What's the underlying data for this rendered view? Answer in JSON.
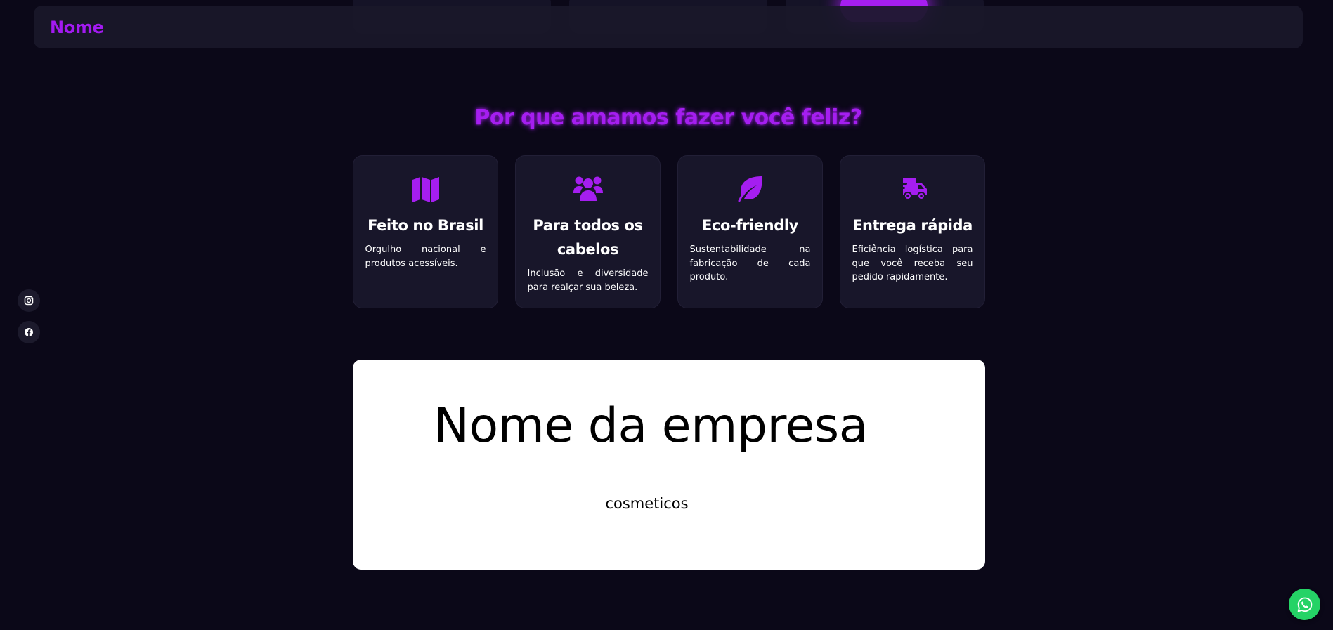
{
  "header": {
    "brand": "Nome"
  },
  "benefits": {
    "title": "Por que amamos fazer você feliz?",
    "items": [
      {
        "icon": "map-icon",
        "title": "Feito no Brasil",
        "text": "Orgulho nacional e produtos acessíveis."
      },
      {
        "icon": "users-icon",
        "title": "Para todos os cabelos",
        "text": "Inclusão e diversidade para realçar sua beleza."
      },
      {
        "icon": "leaf-icon",
        "title": "Eco-friendly",
        "text": "Sustentabilidade na fabricação de cada produto."
      },
      {
        "icon": "truck-fast-icon",
        "title": "Entrega rápida",
        "text": "Eficiência logística para que você receba seu pedido rapidamente."
      }
    ]
  },
  "social": {
    "links": [
      {
        "icon": "instagram-icon"
      },
      {
        "icon": "facebook-icon"
      }
    ]
  },
  "hero": {
    "title": "Nome da empresa",
    "subtitle": "cosmeticos"
  },
  "floating": {
    "icon": "whatsapp-icon"
  },
  "colors": {
    "background": "#0b0818",
    "card": "#18162a",
    "accent": "#a51ef0",
    "whatsapp": "#25d366",
    "hero_background": "#ffffff"
  }
}
